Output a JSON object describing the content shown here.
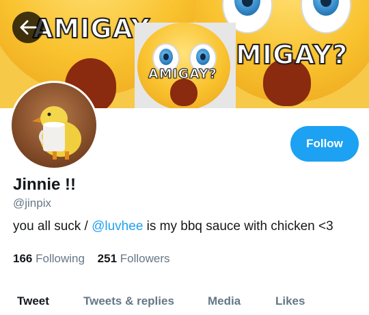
{
  "banner": {
    "left_text": "AMIGAY",
    "right_text": "MIGAY?",
    "inset_text": "AMIGAY?"
  },
  "profile": {
    "name": "Jinnie !!",
    "handle": "@jinpix",
    "bio_before": "you all suck / ",
    "bio_mention": "@luvhee",
    "bio_after": " is my bbq sauce with chicken <3"
  },
  "follow_button": {
    "label": "Follow"
  },
  "stats": {
    "following_count": "166",
    "following_label": "Following",
    "followers_count": "251",
    "followers_label": "Followers"
  },
  "tabs": [
    {
      "label": "Tweet",
      "active": true
    },
    {
      "label": "Tweets & replies",
      "active": false
    },
    {
      "label": "Media",
      "active": false
    },
    {
      "label": "Likes",
      "active": false
    }
  ],
  "colors": {
    "accent": "#1da1f2",
    "text": "#14171a",
    "muted": "#657786"
  }
}
